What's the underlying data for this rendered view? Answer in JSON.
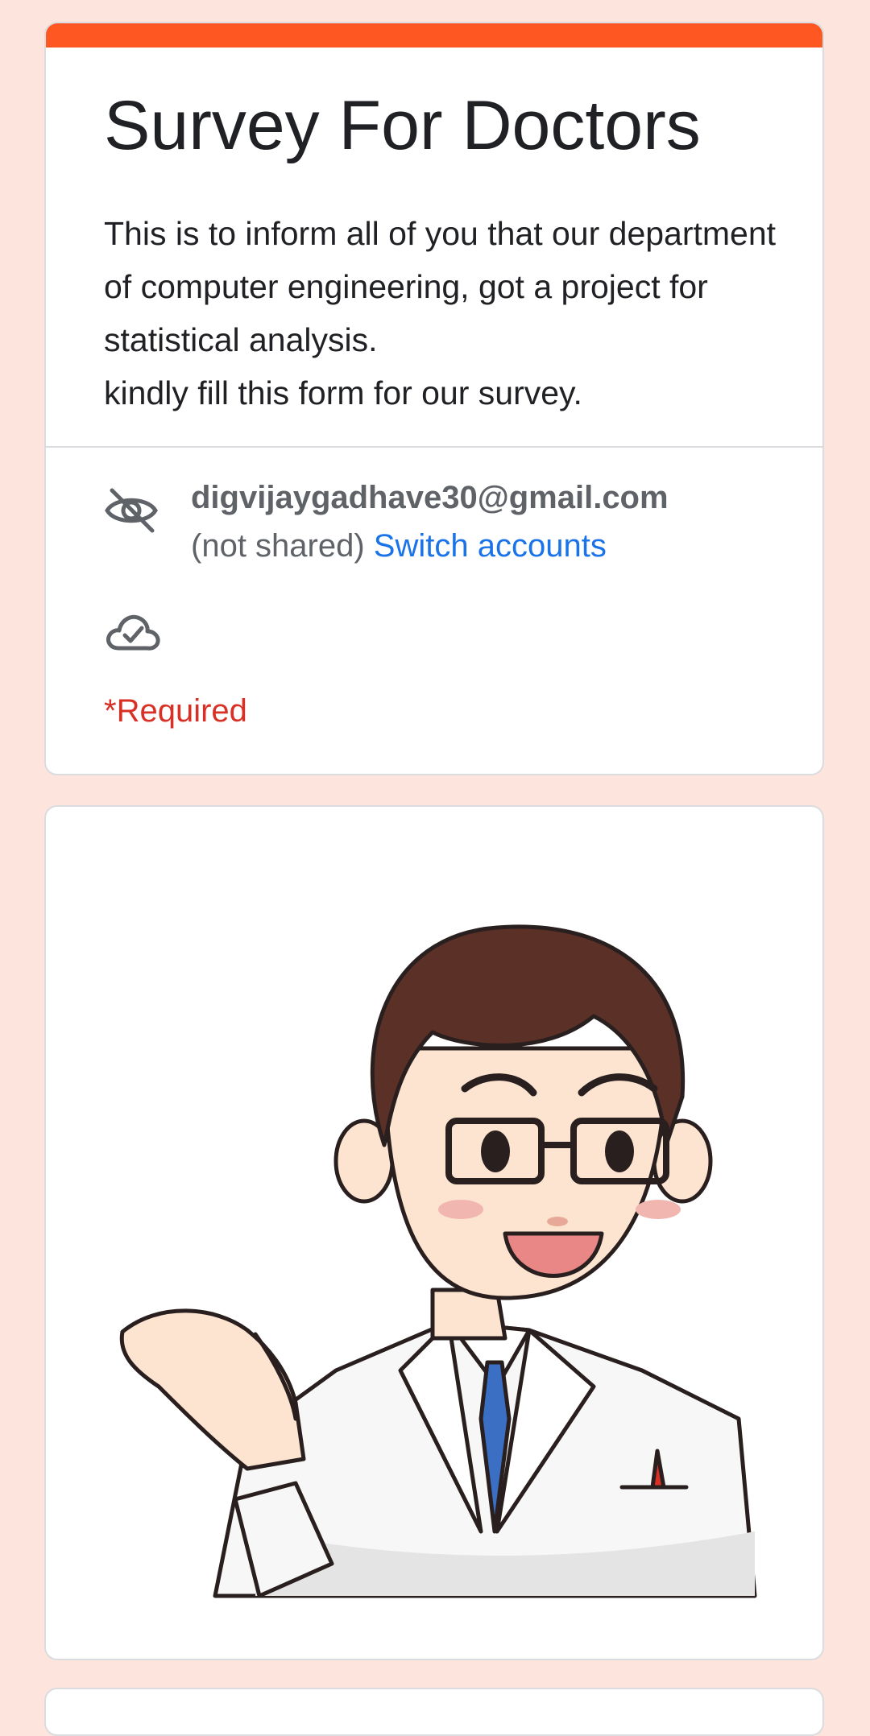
{
  "form": {
    "title": "Survey For Doctors",
    "description": [
      "This is to inform all of you that our department of computer engineering, got a project for statistical analysis.",
      "kindly fill this form for our survey."
    ],
    "account": {
      "email": "digvijaygadhave30@gmail.com",
      "not_shared": "(not shared)",
      "switch_label": "Switch accounts",
      "privacy_icon": "eye-off-icon",
      "save_status_icon": "cloud-check-icon"
    },
    "required_note": "*Required",
    "header_image": "doctor-illustration"
  },
  "colors": {
    "accent": "#ff5722",
    "background": "#fde4dc",
    "link": "#1a73e8",
    "required": "#d93025",
    "text": "#202124",
    "secondary_text": "#5f6368"
  }
}
